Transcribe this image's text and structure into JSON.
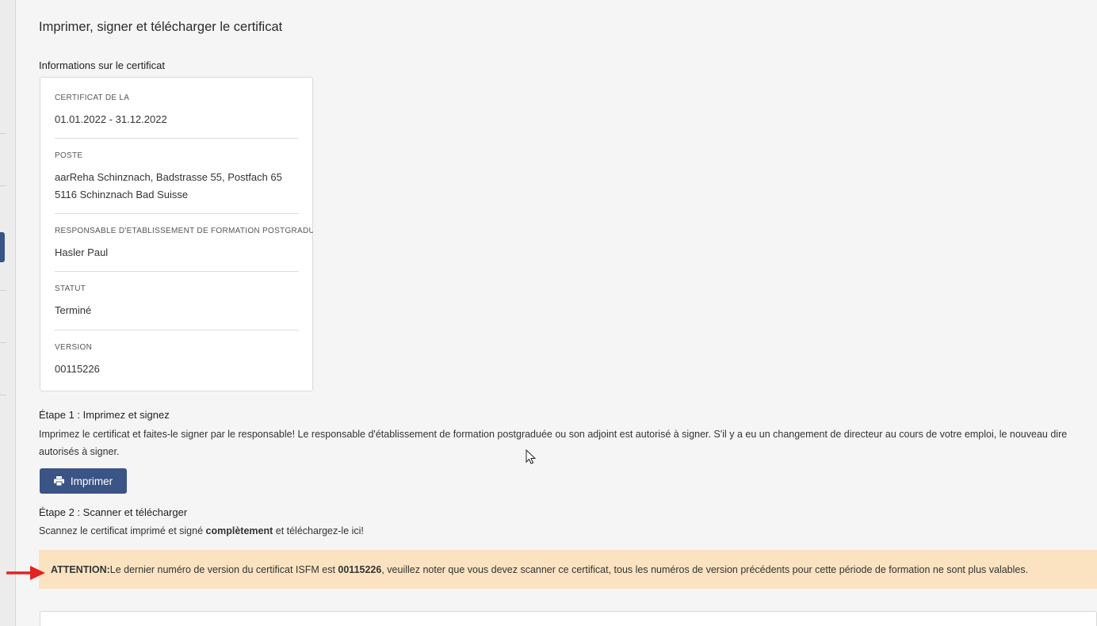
{
  "page": {
    "title": "Imprimer, signer et télécharger le certificat",
    "info_section_label": "Informations sur le certificat"
  },
  "certificate": {
    "period_label": "CERTIFICAT DE LA",
    "period_value": "01.01.2022 - 31.12.2022",
    "post_label": "POSTE",
    "post_value_line1": "aarReha Schinznach, Badstrasse 55, Postfach 65",
    "post_value_line2": "5116 Schinznach Bad Suisse",
    "head_label": "RESPONSABLE D'ÉTABLISSEMENT DE FORMATION POSTGRADUÉE",
    "head_value": "Hasler Paul",
    "status_label": "STATUT",
    "status_value": "Terminé",
    "version_label": "VERSION",
    "version_value": "00115226"
  },
  "step1": {
    "title": "Étape 1 : Imprimez et signez",
    "text_line1": "Imprimez le certificat et faites-le signer par le responsable! Le responsable d'établissement de formation postgraduée ou son adjoint est autorisé à signer. S'il y a eu un changement de directeur au cours de votre emploi, le nouveau dire",
    "text_line2": "autorisés à signer.",
    "print_button": "Imprimer",
    "print_icon": "printer-icon"
  },
  "step2": {
    "title": "Étape 2 : Scanner et télécharger",
    "text_before": "Scannez le certificat imprimé et signé ",
    "text_bold": "complètement",
    "text_after": " et téléchargez-le ici!"
  },
  "alert": {
    "label": "ATTENTION:",
    "text_before": " Le dernier numéro de version du certificat ISFM est ",
    "version": "00115226",
    "text_after": ", veuillez noter que vous devez scanner ce certificat, tous les numéros de version précédents pour cette période de formation ne sont plus valables.",
    "background": "#fbe3c1"
  },
  "annotation": {
    "arrow_color": "#e52222",
    "arrow_icon": "red-arrow-icon"
  },
  "colors": {
    "primary": "#3b5486",
    "page_background": "#f5f5f5"
  }
}
